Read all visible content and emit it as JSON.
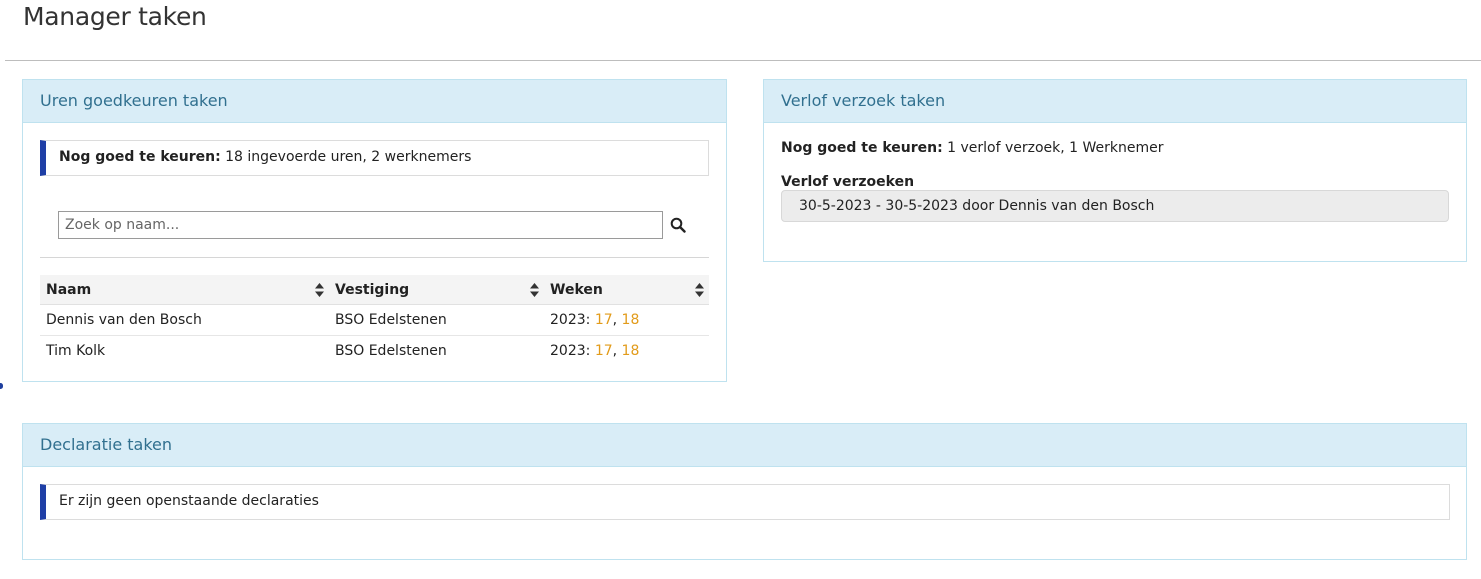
{
  "page": {
    "title": "Manager taken"
  },
  "hours_panel": {
    "title": "Uren goedkeuren taken",
    "summary_label": "Nog goed te keuren:",
    "summary_value": "18 ingevoerde uren, 2 werknemers",
    "search": {
      "placeholder": "Zoek op naam...",
      "value": "",
      "icon": "search-icon"
    },
    "columns": [
      "Naam",
      "Vestiging",
      "Weken"
    ],
    "rows": [
      {
        "name": "Dennis van den Bosch",
        "location": "BSO Edelstenen",
        "year": "2023:",
        "weeks": [
          "17",
          "18"
        ]
      },
      {
        "name": "Tim Kolk",
        "location": "BSO Edelstenen",
        "year": "2023:",
        "weeks": [
          "17",
          "18"
        ]
      }
    ],
    "week_separator": ", "
  },
  "leave_panel": {
    "title": "Verlof verzoek taken",
    "summary_label": "Nog goed te keuren:",
    "summary_value": "1 verlof verzoek, 1 Werknemer",
    "list_label": "Verlof verzoeken",
    "requests": [
      "30-5-2023 - 30-5-2023 door Dennis van den Bosch"
    ]
  },
  "declaration_panel": {
    "title": "Declaratie taken",
    "message": "Er zijn geen openstaande declaraties"
  },
  "colors": {
    "panel_heading_bg": "#d9edf7",
    "panel_heading_text": "#31708f",
    "note_accent": "#1f3fa6",
    "week_link": "#e29b1a"
  }
}
